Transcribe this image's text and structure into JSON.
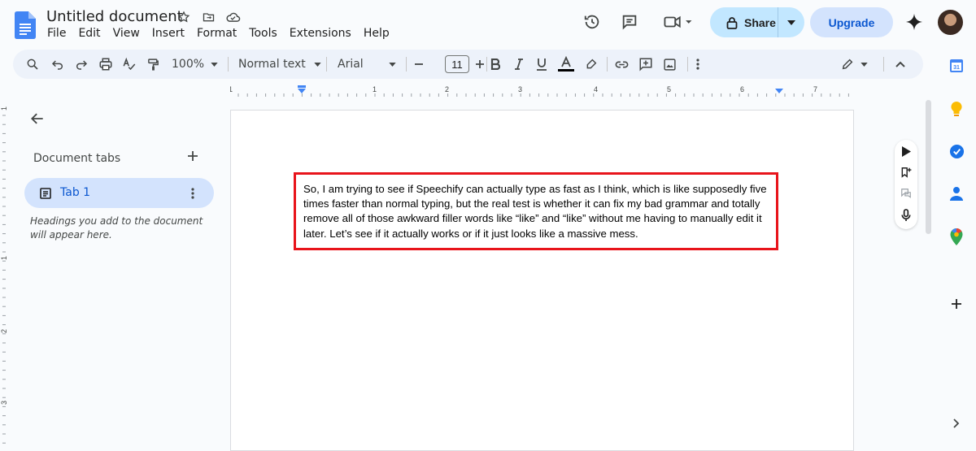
{
  "header": {
    "title": "Untitled document",
    "menu": [
      "File",
      "Edit",
      "View",
      "Insert",
      "Format",
      "Tools",
      "Extensions",
      "Help"
    ],
    "share_label": "Share",
    "upgrade_label": "Upgrade"
  },
  "toolbar": {
    "zoom": "100%",
    "style": "Normal text",
    "font": "Arial",
    "font_size": "11"
  },
  "ruler": {
    "labels": [
      "1",
      "1",
      "2",
      "3",
      "4",
      "5",
      "6",
      "7"
    ]
  },
  "vruler": {
    "labels": [
      "1",
      "1",
      "2",
      "3"
    ]
  },
  "sidebar": {
    "heading": "Document tabs",
    "tab_label": "Tab 1",
    "hint": "Headings you add to the document will appear here."
  },
  "document": {
    "text": "So, I am trying to see if Speechify can actually type as fast as I think, which is like supposedly five times faster than normal typing, but the real test is whether it can fix my bad grammar and totally remove all of those awkward filler words like “like” and “like” without me having to manually edit it later. Let’s see if it actually works or if it just looks like a massive mess."
  },
  "right_rail": {
    "calendar_day": "31"
  },
  "colors": {
    "accent": "#0b57d0",
    "highlight_border": "#e8141b",
    "share_bg": "#c2e7ff",
    "toolbar_bg": "#edf2fa"
  }
}
